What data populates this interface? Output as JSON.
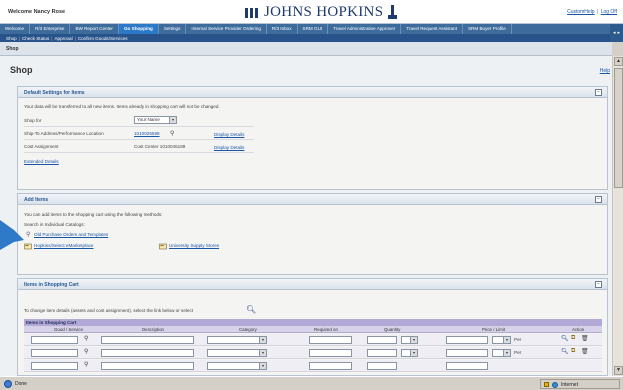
{
  "header": {
    "welcome": "Welcome Nancy Rose",
    "logo_text": "JOHNS HOPKINS",
    "links": [
      "CustomHelp",
      "Log Off"
    ]
  },
  "tabs": [
    {
      "label": "Welcome"
    },
    {
      "label": "R/3 Enterprise"
    },
    {
      "label": "BW Report Center"
    },
    {
      "label": "Go Shopping",
      "active": true
    },
    {
      "label": "Settings"
    },
    {
      "label": "Internal Service Provider Ordering"
    },
    {
      "label": "R/3 Inbox"
    },
    {
      "label": "SRM GUI"
    },
    {
      "label": "Travel Administrative Approver"
    },
    {
      "label": "Travel Request Assistant"
    },
    {
      "label": "SRM Buyer Profile"
    }
  ],
  "subnav": [
    "Shop",
    "Check Status",
    "Approval",
    "Confirm Goods/Services"
  ],
  "breadcrumb": "Shop",
  "page": {
    "title": "Shop",
    "help": "Help"
  },
  "defaults_panel": {
    "title": "Default Settings for Items",
    "intro": "Your data will be transferred to all new items. Items already in shopping cart will not be changed.",
    "shop_for_label": "Shop for",
    "shop_for_value": "Your Name",
    "ship_to_label": "Ship-To Address/Performance Location",
    "ship_to_value": "1010025598",
    "cost_label": "Cost Assignment",
    "cost_value": "Cost Center  1010045189",
    "display_details": "Display Details",
    "extended_details": "Extended Details"
  },
  "add_items_panel": {
    "title": "Add Items",
    "intro": "You can add items to the shopping cart using the following methods:",
    "search_label": "Search in Individual Catalogs:",
    "old_orders": "Old Purchase Orders and Templates",
    "hopkins": "Hopkins/Select eMarketplace",
    "university": "University Supply Stores"
  },
  "cart_panel": {
    "title": "Items in Shopping Cart",
    "intro": "To change item details (assets and cost assignment), select the link below or select",
    "table_title": "Items in Shopping Cart",
    "columns": [
      "Good / Service",
      "Description",
      "Category",
      "Required on",
      "Quantity",
      "Price / Limit",
      "Action"
    ],
    "per_label": "Per"
  },
  "statusbar": {
    "left": "Done",
    "zone": "Internet"
  },
  "colors": {
    "tabbar": "#3d6c9c",
    "subnav": "#27528a",
    "accent_link": "#1a56a6",
    "table_header": "#b3a9d6"
  }
}
